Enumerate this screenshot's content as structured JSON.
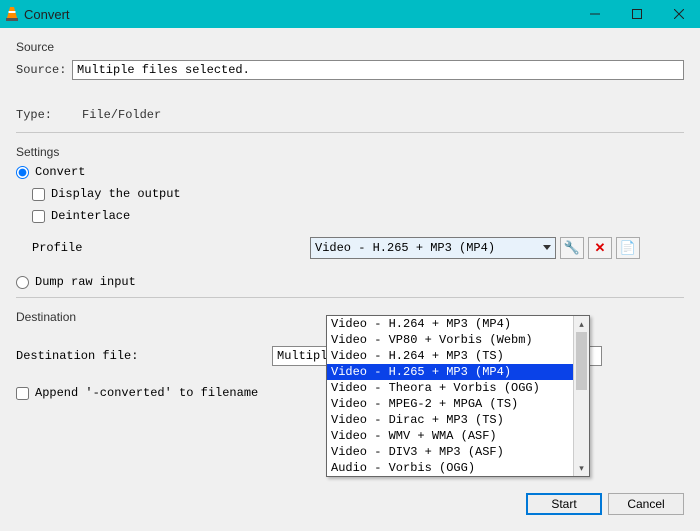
{
  "window": {
    "title": "Convert"
  },
  "source": {
    "section_label": "Source",
    "label": "Source:",
    "value": "Multiple files selected.",
    "type_label": "Type:",
    "type_value": "File/Folder"
  },
  "settings": {
    "section_label": "Settings",
    "convert_label": "Convert",
    "display_output_label": "Display the output",
    "deinterlace_label": "Deinterlace",
    "profile_label": "Profile",
    "profile_value": "Video - H.265 + MP3 (MP4)",
    "dump_label": "Dump raw input",
    "profile_options": [
      "Video - H.264 + MP3 (MP4)",
      "Video - VP80 + Vorbis (Webm)",
      "Video - H.264 + MP3 (TS)",
      "Video - H.265 + MP3 (MP4)",
      "Video - Theora + Vorbis (OGG)",
      "Video - MPEG-2 + MPGA (TS)",
      "Video - Dirac + MP3 (TS)",
      "Video - WMV + WMA (ASF)",
      "Video - DIV3 + MP3 (ASF)",
      "Audio - Vorbis (OGG)"
    ],
    "selected_index": 3
  },
  "destination": {
    "section_label": "Destination",
    "file_label": "Destination file:",
    "file_value": "Multiple Fil",
    "append_label": "Append '-converted' to filename"
  },
  "buttons": {
    "start": "Start",
    "cancel": "Cancel"
  },
  "icons": {
    "wrench": "🔧",
    "delete": "✕",
    "new": "📄"
  }
}
